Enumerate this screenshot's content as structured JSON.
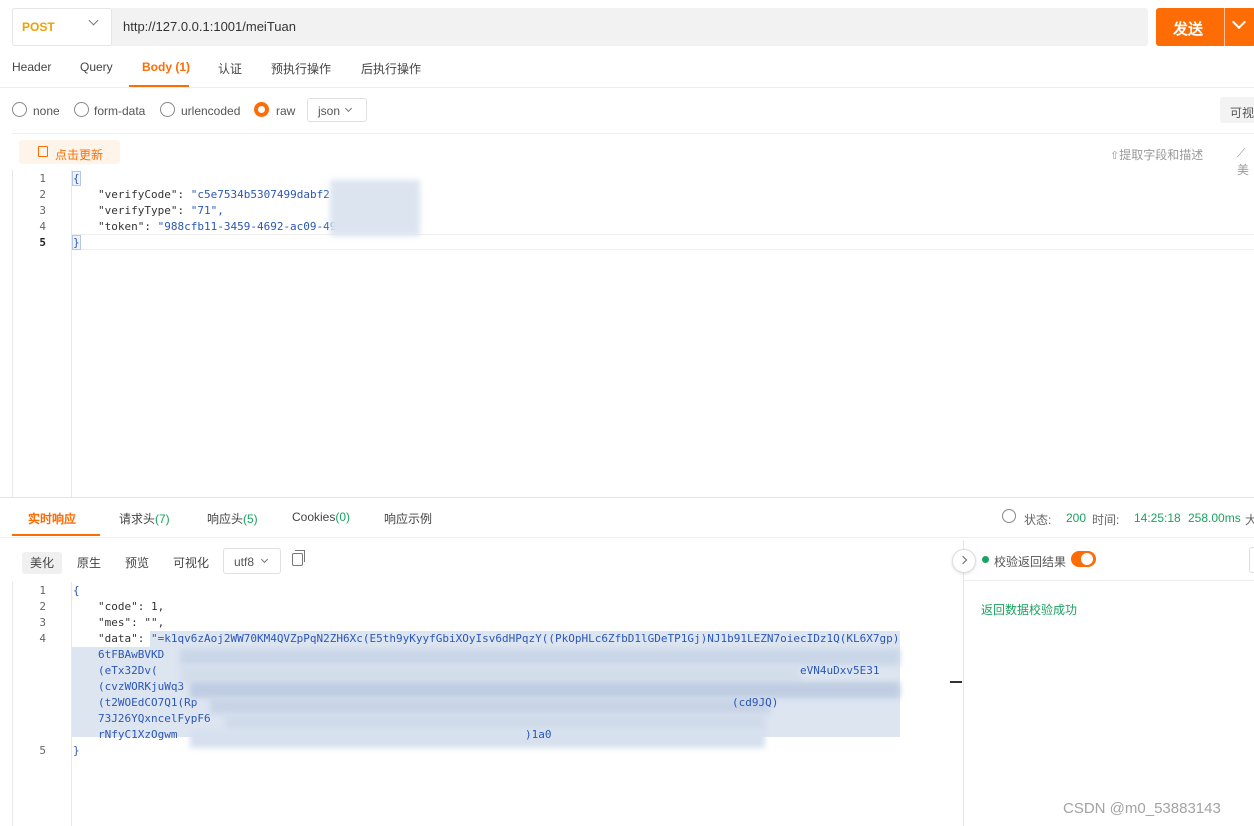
{
  "request": {
    "method": "POST",
    "url": "http://127.0.0.1:1001/meiTuan",
    "send_label": "发送"
  },
  "request_tabs": [
    "Header",
    "Query",
    "Body (1)",
    "认证",
    "预执行操作",
    "后执行操作"
  ],
  "body_types": {
    "none": "none",
    "form_data": "form-data",
    "urlencoded": "urlencoded",
    "raw": "raw",
    "format": "json",
    "view_label": "可视"
  },
  "body_toolbar": {
    "update_label": "点击更新",
    "extract_label": "提取字段和描述",
    "extra_label": "美"
  },
  "request_body": {
    "line_numbers": [
      "1",
      "2",
      "3",
      "4",
      "5"
    ],
    "open": "{",
    "close": "}",
    "fields": [
      {
        "key": "\"verifyCode\"",
        "value": "\"c5e7534b5307499dabf2"
      },
      {
        "key": "\"verifyType\"",
        "value": "\"71\","
      },
      {
        "key": "\"token\"",
        "value": "\"988cfb11-3459-4692-ac09-49"
      }
    ]
  },
  "response_tabs": {
    "realtime": "实时响应",
    "req_headers": "请求头",
    "req_headers_count": "(7)",
    "resp_headers": "响应头",
    "resp_headers_count": "(5)",
    "cookies": "Cookies",
    "cookies_count": "(0)",
    "example": "响应示例"
  },
  "status": {
    "status_label": "状态:",
    "status_value": "200",
    "time_label": "时间:",
    "time_value": "14:25:18",
    "duration": "258.00ms",
    "size_label": "大"
  },
  "response_toolbar": {
    "pretty": "美化",
    "raw": "原生",
    "preview": "预览",
    "visual": "可视化",
    "encoding": "utf8"
  },
  "response_body": {
    "line_numbers": [
      "1",
      "2",
      "3",
      "4",
      "",
      "",
      "",
      "",
      "",
      "",
      "",
      "5"
    ],
    "open": "{",
    "close": "}",
    "code_line": "\"code\": 1,",
    "mes_line": "\"mes\": \"\",",
    "data_key": "\"data\": ",
    "data_lines": [
      "\"=k1qv6zAoj2WW70KM4QVZpPqN2ZH6Xc(E5th9yKyyfGbiXOyIsv6dHPqzY((PkOpHLc6ZfbD1lGDeTP1Gj)NJ1b91LEZN7oiecIDz1Q(KL6X7gp)",
      "6tFBAwBVKD",
      "(eTx32Dv(",
      "(cvzWORKjuWq3",
      "(t2WOEdCO7Q1(Rp",
      "73J26YQxncelFypF6",
      "rNfyC1XzOgwm"
    ],
    "data_tail_1": "eVN4uDxv5E31",
    "data_tail_2": "(cd9JQ)",
    "data_tail_3": ")1a0"
  },
  "validation": {
    "label": "校验返回结果",
    "success": "返回数据校验成功"
  },
  "watermark": "CSDN @m0_53883143",
  "colors": {
    "accent": "#fd6c05",
    "success": "#1aa260",
    "method": "#f0a000"
  }
}
